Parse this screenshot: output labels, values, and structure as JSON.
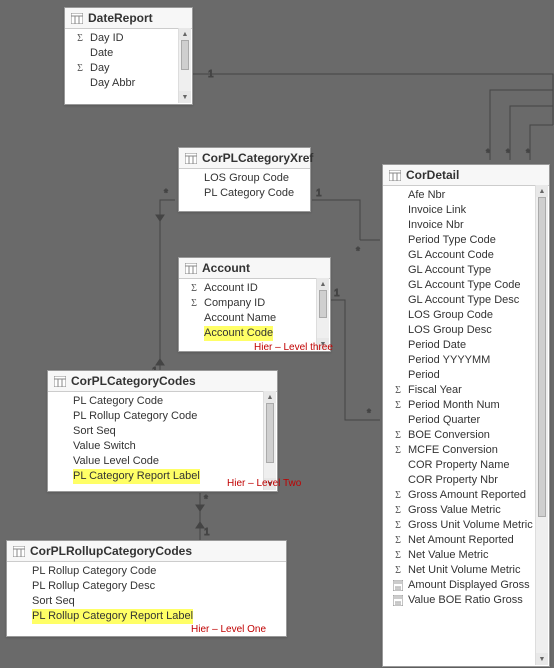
{
  "annotations": {
    "level_one": "Hier – Level One",
    "level_two": "Hier – Level Two",
    "level_three": "Hier – Level three"
  },
  "tables": {
    "dateReport": {
      "title": "DateReport",
      "fields": [
        {
          "icon": "sigma",
          "label": "Day ID"
        },
        {
          "icon": "none",
          "label": "Date"
        },
        {
          "icon": "sigma",
          "label": "Day"
        },
        {
          "icon": "none",
          "label": "Day Abbr"
        }
      ]
    },
    "corPLCategoryXref": {
      "title": "CorPLCategoryXref",
      "fields": [
        {
          "icon": "none",
          "label": "LOS Group Code"
        },
        {
          "icon": "none",
          "label": "PL Category Code"
        }
      ]
    },
    "account": {
      "title": "Account",
      "fields": [
        {
          "icon": "sigma",
          "label": "Account ID"
        },
        {
          "icon": "sigma",
          "label": "Company ID"
        },
        {
          "icon": "none",
          "label": "Account Name"
        },
        {
          "icon": "none",
          "label": "Account Code",
          "highlight": true
        }
      ]
    },
    "corPLCategoryCodes": {
      "title": "CorPLCategoryCodes",
      "fields": [
        {
          "icon": "none",
          "label": "PL Category Code"
        },
        {
          "icon": "none",
          "label": "PL Rollup Category Code"
        },
        {
          "icon": "none",
          "label": "Sort Seq"
        },
        {
          "icon": "none",
          "label": "Value Switch"
        },
        {
          "icon": "none",
          "label": "Value Level Code"
        },
        {
          "icon": "none",
          "label": "PL Category Report Label",
          "highlight": true
        }
      ]
    },
    "corPLRollupCategoryCodes": {
      "title": "CorPLRollupCategoryCodes",
      "fields": [
        {
          "icon": "none",
          "label": "PL Rollup Category Code"
        },
        {
          "icon": "none",
          "label": "PL Rollup Category Desc"
        },
        {
          "icon": "none",
          "label": "Sort Seq"
        },
        {
          "icon": "none",
          "label": "PL Rollup Category Report Label",
          "highlight": true
        }
      ]
    },
    "corDetail": {
      "title": "CorDetail",
      "fields": [
        {
          "icon": "none",
          "label": "Afe Nbr"
        },
        {
          "icon": "none",
          "label": "Invoice Link"
        },
        {
          "icon": "none",
          "label": "Invoice Nbr"
        },
        {
          "icon": "none",
          "label": "Period Type Code"
        },
        {
          "icon": "none",
          "label": "GL Account Code"
        },
        {
          "icon": "none",
          "label": "GL Account Type"
        },
        {
          "icon": "none",
          "label": "GL Account Type Code"
        },
        {
          "icon": "none",
          "label": "GL Account Type Desc"
        },
        {
          "icon": "none",
          "label": "LOS Group Code"
        },
        {
          "icon": "none",
          "label": "LOS Group Desc"
        },
        {
          "icon": "none",
          "label": "Period Date"
        },
        {
          "icon": "none",
          "label": "Period YYYYMM"
        },
        {
          "icon": "none",
          "label": "Period"
        },
        {
          "icon": "sigma",
          "label": "Fiscal Year"
        },
        {
          "icon": "sigma",
          "label": "Period Month Num"
        },
        {
          "icon": "none",
          "label": "Period Quarter"
        },
        {
          "icon": "sigma",
          "label": "BOE Conversion"
        },
        {
          "icon": "sigma",
          "label": "MCFE Conversion"
        },
        {
          "icon": "none",
          "label": "COR Property Name"
        },
        {
          "icon": "none",
          "label": "COR Property Nbr"
        },
        {
          "icon": "sigma",
          "label": "Gross Amount Reported"
        },
        {
          "icon": "sigma",
          "label": "Gross Value Metric"
        },
        {
          "icon": "sigma",
          "label": "Gross Unit Volume Metric"
        },
        {
          "icon": "sigma",
          "label": "Net Amount Reported"
        },
        {
          "icon": "sigma",
          "label": "Net Value Metric"
        },
        {
          "icon": "sigma",
          "label": "Net Unit Volume Metric"
        },
        {
          "icon": "calc",
          "label": "Amount Displayed Gross"
        },
        {
          "icon": "calc",
          "label": "Value BOE Ratio Gross"
        }
      ]
    }
  }
}
